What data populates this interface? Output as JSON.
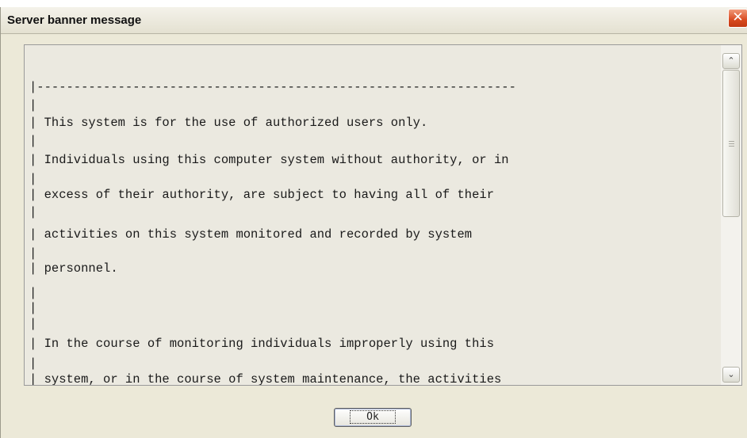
{
  "top_fragment": "... ... ... ...",
  "window": {
    "title": "Server banner message",
    "close_glyph": "✕"
  },
  "banner_lines": [
    "|-----------------------------------------------------------------",
    "|",
    "| This system is for the use of authorized users only.",
    "|",
    "| Individuals using this computer system without authority, or in",
    "|",
    "| excess of their authority, are subject to having all of their",
    "|",
    "| activities on this system monitored and recorded by system",
    "|",
    "| personnel.",
    "|",
    "|",
    "|",
    "| In the course of monitoring individuals improperly using this",
    "|",
    "| system, or in the course of system maintenance, the activities"
  ],
  "scrollbar": {
    "up_icon": "up-arrow-icon",
    "down_icon": "down-arrow-icon",
    "up_glyph": "⌃",
    "down_glyph": "⌄"
  },
  "buttons": {
    "ok_label": "Ok"
  }
}
